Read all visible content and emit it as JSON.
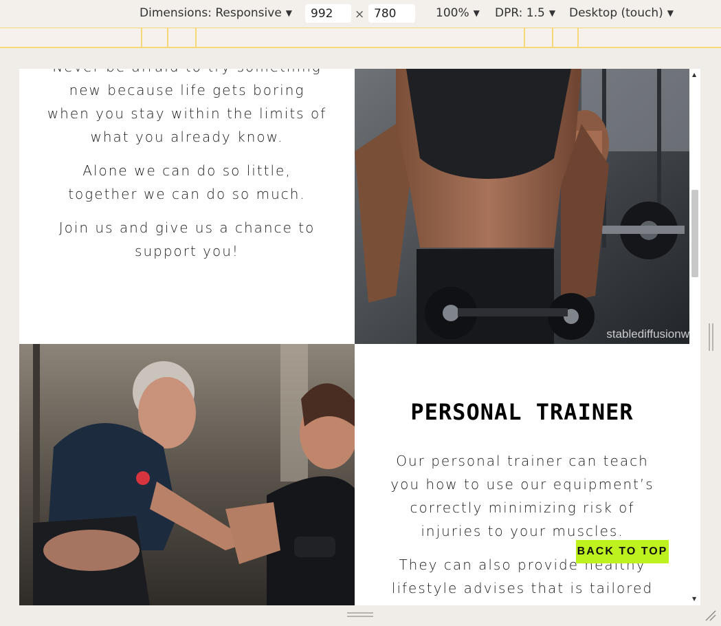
{
  "devtools": {
    "dimensions_label": "Dimensions: Responsive",
    "width_value": "992",
    "height_value": "780",
    "times": "×",
    "zoom": "100%",
    "dpr": "DPR: 1.5",
    "device_mode": "Desktop (touch)",
    "caret": "▼"
  },
  "page": {
    "intro_paragraphs": [
      "Never be afraid to try something new because life gets boring when you stay within the limits of what you already know.",
      "Alone we can do so little, together we can do so much.",
      "Join us and give us a chance to support you!"
    ],
    "woman_image_watermark": "stablediffusionw",
    "section_heading": "PERSONAL TRAINER",
    "trainer_paragraphs": [
      "Our personal trainer can teach you how to use our equipment’s correctly minimizing risk of injuries to your muscles.",
      "They can also provide healthy lifestyle advises that is tailored"
    ],
    "back_to_top": "BACK TO TOP"
  },
  "colors": {
    "accent_button": "#bef21f",
    "media_query_bar": "#f6d879"
  }
}
